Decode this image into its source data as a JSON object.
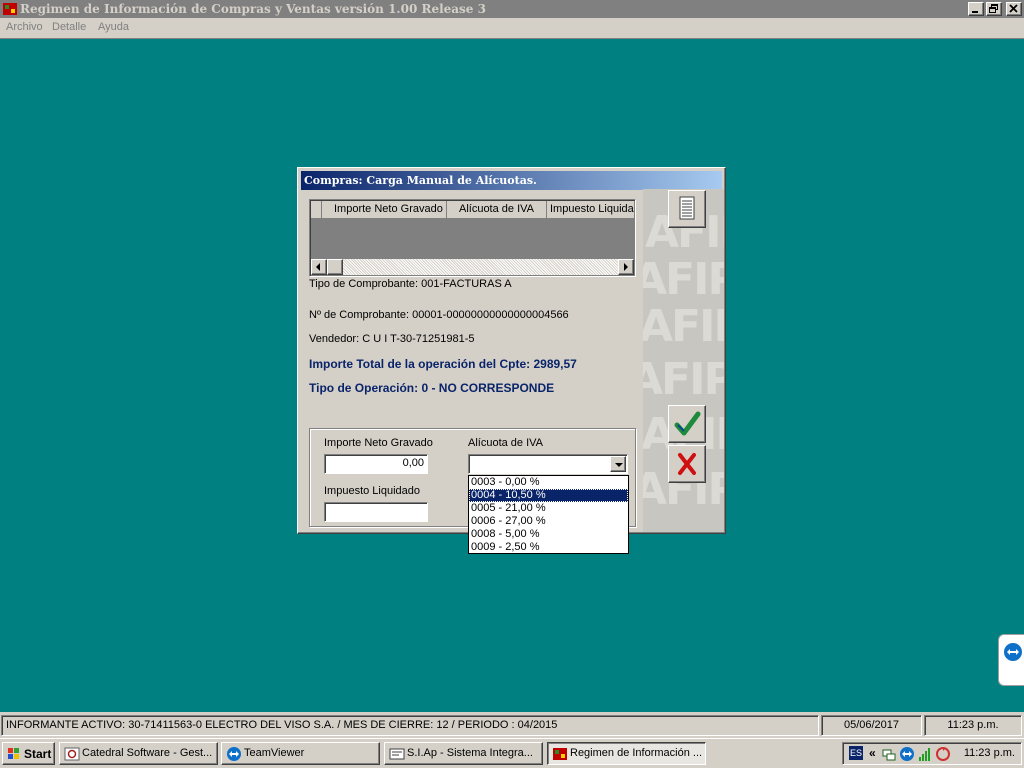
{
  "app": {
    "title": "Regimen de Información de Compras y Ventas versión 1.00   Release 3"
  },
  "menu": {
    "items": [
      "Archivo",
      "Detalle",
      "Ayuda"
    ]
  },
  "dialog": {
    "title": "Compras: Carga Manual de Alícuotas.",
    "grid": {
      "columns": [
        "Importe Neto Gravado",
        "Alícuota de IVA",
        "Impuesto Liquidad"
      ]
    },
    "tipo_comprobante": "Tipo de Comprobante: 001-FACTURAS A",
    "nro_comprobante": "Nº de Comprobante: 00001-00000000000000004566",
    "vendedor": "Vendedor: C U I T-30-71251981-5",
    "importe_total": "Importe Total de la operación del Cpte: 2989,57",
    "tipo_operacion": "Tipo de Operación: 0 - NO CORRESPONDE",
    "form": {
      "importe_neto_label": "Importe Neto Gravado",
      "importe_neto_value": "0,00",
      "alicuota_label": "Alícuota de IVA",
      "alicuota_value": "",
      "impuesto_label": "Impuesto Liquidado",
      "impuesto_value": ""
    },
    "dropdown_options": [
      "0003 - 0,00 %",
      "0004 - 10,50 %",
      "0005 - 21,00 %",
      "0006 - 27,00 %",
      "0008 - 5,00 %",
      "0009 - 2,50 %"
    ],
    "dropdown_selected_index": 1,
    "side_panel": {
      "watermark": "AFIP",
      "buttons": [
        "list-icon",
        "check-icon",
        "cross-icon"
      ]
    }
  },
  "statusbar": {
    "informante": "INFORMANTE ACTIVO: 30-71411563-0 ELECTRO DEL VISO S.A. / MES DE CIERRE: 12 / PERIODO : 04/2015",
    "date": "05/06/2017",
    "time": "11:23 p.m."
  },
  "taskbar": {
    "start_label": "Start",
    "tasks": [
      {
        "label": "Catedral Software - Gest...",
        "icon": "catedral-icon"
      },
      {
        "label": "TeamViewer",
        "icon": "teamviewer-icon"
      },
      {
        "label": "S.I.Ap - Sistema Integra...",
        "icon": "siap-icon"
      },
      {
        "label": "Regimen de Información ...",
        "icon": "afip-app-icon"
      }
    ],
    "tray_language": "ES",
    "clock": "11:23 p.m."
  },
  "colors": {
    "desktop": "#008080",
    "title_active": "#0a246a",
    "title_inactive": "#808080",
    "selection": "#0a246a",
    "label_blue": "#0a246a",
    "accept_green": "#1e8a3c",
    "cancel_red": "#d01010"
  }
}
